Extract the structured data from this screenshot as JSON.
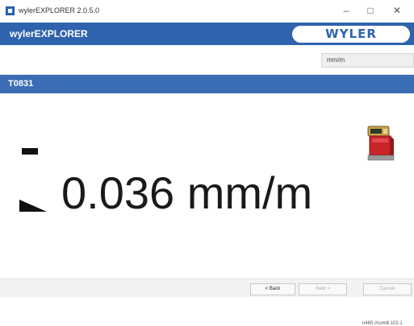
{
  "window": {
    "title": "wylerEXPLORER 2.0.5.0",
    "minimize": "–",
    "maximize": "□",
    "close": "✕"
  },
  "header": {
    "app_name": "wylerEXPLORER",
    "logo_text": "WYLER"
  },
  "toolbar": {
    "unit_select_value": "mm/m"
  },
  "device": {
    "id": "T0831"
  },
  "measurement": {
    "value": "0.036 mm/m",
    "connection": "n485://com8:102.1"
  },
  "footer": {
    "back": "< Back",
    "next": "Next >",
    "cancel": "Cancel"
  },
  "colors": {
    "header_blue": "#2f63ad",
    "device_bar_blue": "#3b6db5"
  }
}
